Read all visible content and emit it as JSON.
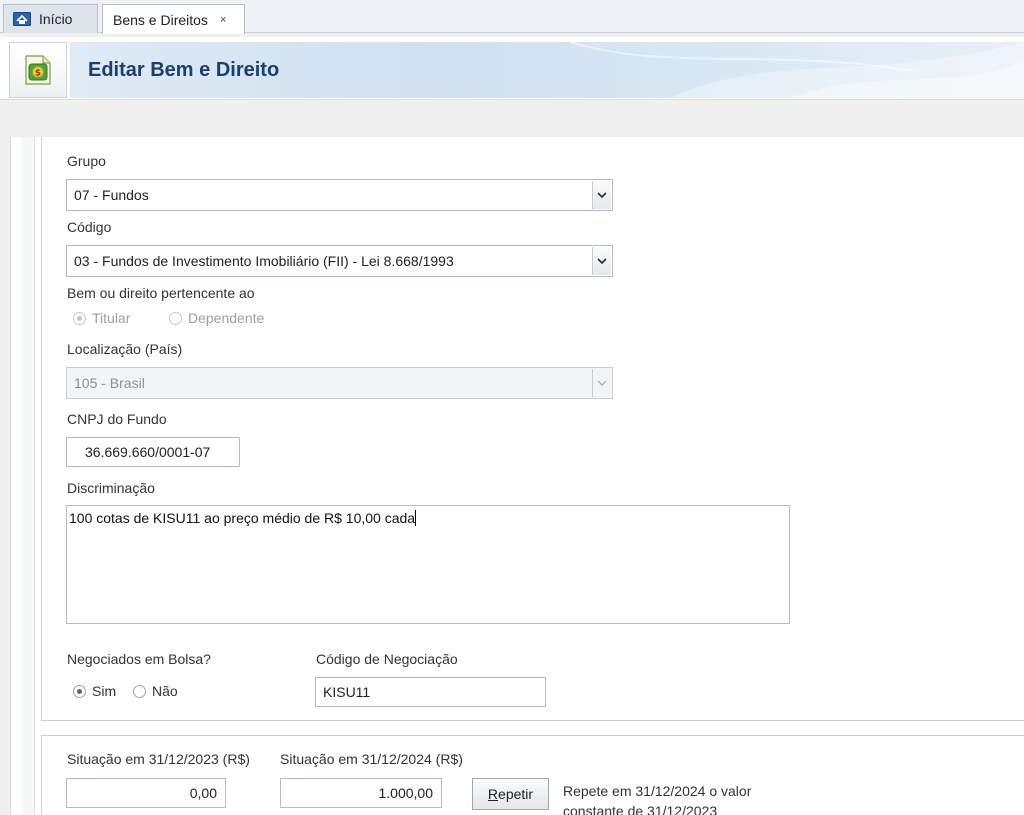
{
  "tabs": {
    "home_label": "Início",
    "active_label": "Bens e Direitos",
    "close_glyph": "×"
  },
  "header": {
    "title": "Editar Bem e Direito",
    "icon": "money-document-icon"
  },
  "form": {
    "grupo": {
      "label": "Grupo",
      "value": "07 - Fundos"
    },
    "codigo": {
      "label": "Código",
      "value": "03 - Fundos de Investimento Imobiliário (FII) - Lei 8.668/1993"
    },
    "pertencente": {
      "label": "Bem ou direito pertencente ao",
      "options": [
        "Titular",
        "Dependente"
      ],
      "selected": "Titular"
    },
    "localizacao": {
      "label": "Localização (País)",
      "value": "105 - Brasil"
    },
    "cnpj": {
      "label": "CNPJ do Fundo",
      "value": "36.669.660/0001-07"
    },
    "discriminacao": {
      "label": "Discriminação",
      "value": "100 cotas de KISU11 ao preço médio de R$ 10,00 cada"
    },
    "bolsa": {
      "label": "Negociados em Bolsa?",
      "options": [
        "Sim",
        "Não"
      ],
      "selected": "Sim"
    },
    "codigo_negociacao": {
      "label": "Código de Negociação",
      "value": "KISU11"
    }
  },
  "situacao": {
    "label_2023": "Situação em 31/12/2023 (R$)",
    "value_2023": "0,00",
    "label_2024": "Situação em 31/12/2024 (R$)",
    "value_2024": "1.000,00",
    "repeat_button_first": "R",
    "repeat_button_rest": "epetir",
    "repeat_hint_line1": "Repete em 31/12/2024 o valor",
    "repeat_hint_line2": "constante de 31/12/2023"
  },
  "colors": {
    "title": "#1b3f6b",
    "border": "#b4bcc6"
  }
}
